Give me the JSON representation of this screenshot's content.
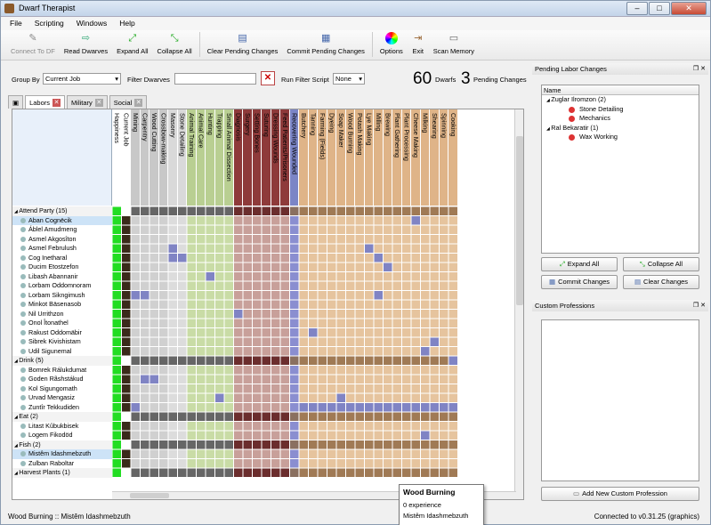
{
  "window": {
    "title": "Dwarf Therapist"
  },
  "menu": [
    "File",
    "Scripting",
    "Windows",
    "Help"
  ],
  "toolbar": {
    "connect": "Connect To DF",
    "read": "Read Dwarves",
    "expand": "Expand All",
    "collapse": "Collapse All",
    "clear": "Clear Pending Changes",
    "commit": "Commit Pending Changes",
    "options": "Options",
    "exit": "Exit",
    "scan": "Scan Memory"
  },
  "controls": {
    "group_by_label": "Group By",
    "group_by_value": "Current Job",
    "filter_label": "Filter Dwarves",
    "filter_value": "",
    "script_label": "Run Filter Script",
    "script_value": "None",
    "dwarf_count": "60",
    "dwarfs_label": "Dwarfs",
    "pending_count": "3",
    "pending_label": "Pending Changes"
  },
  "tabs": [
    "Labors",
    "Military",
    "Social"
  ],
  "columns": [
    "Happiness",
    "Current Job",
    "Mining",
    "Carpentry",
    "Wood Cutting",
    "Crossbow-making",
    "Masonry",
    "Stone Detailing",
    "Animal Training",
    "Animal Care",
    "Hunting",
    "Trapping",
    "Small Animal Dissection",
    "Diagnosis",
    "Surgery",
    "Setting Bones",
    "Suturing",
    "Dressing Wounds",
    "Feed Patients/Prisoners",
    "Recovering Wounded",
    "Butchery",
    "Tanning",
    "Farming (Fields)",
    "Dyeing",
    "Soap Maker",
    "Wood Burning",
    "Potash Making",
    "Lye Making",
    "Milling",
    "Brewing",
    "Plant Gathering",
    "Plant Processing",
    "Cheese Making",
    "Milking",
    "Shearing",
    "Spinning",
    "Cooking"
  ],
  "rows": [
    {
      "type": "group",
      "label": "Attend Party (15)"
    },
    {
      "type": "dwarf",
      "name": "Aban Cognëcik",
      "selected": true
    },
    {
      "type": "dwarf",
      "name": "Áblel Amudmeng"
    },
    {
      "type": "dwarf",
      "name": "Asmel Akgosîton"
    },
    {
      "type": "dwarf",
      "name": "Asmel Februlush"
    },
    {
      "type": "dwarf",
      "name": "Cog Inetharal"
    },
    {
      "type": "dwarf",
      "name": "Ducim Etostzefon"
    },
    {
      "type": "dwarf",
      "name": "Libash Abannanir"
    },
    {
      "type": "dwarf",
      "name": "Lorbam Oddomnoram"
    },
    {
      "type": "dwarf",
      "name": "Lorbam Sikngimush"
    },
    {
      "type": "dwarf",
      "name": "Minkot Bäsenasob"
    },
    {
      "type": "dwarf",
      "name": "Nil Urrithzon"
    },
    {
      "type": "dwarf",
      "name": "Onol Îtonathel"
    },
    {
      "type": "dwarf",
      "name": "Rakust Oddomäbir"
    },
    {
      "type": "dwarf",
      "name": "Sibrek Kivishistam"
    },
    {
      "type": "dwarf",
      "name": "Udil Sigunemal"
    },
    {
      "type": "group",
      "label": "Drink (5)"
    },
    {
      "type": "dwarf",
      "name": "Bomrek Rálukdumat"
    },
    {
      "type": "dwarf",
      "name": "Goden Rãshstákud"
    },
    {
      "type": "dwarf",
      "name": "Kol Sigungomath"
    },
    {
      "type": "dwarf",
      "name": "Urvad Mengasiz"
    },
    {
      "type": "dwarf",
      "name": "Zuntîr Tekkudiden"
    },
    {
      "type": "group",
      "label": "Eat (2)"
    },
    {
      "type": "dwarf",
      "name": "Litast Kûbukbisek"
    },
    {
      "type": "dwarf",
      "name": "Logem Fikodöd"
    },
    {
      "type": "group",
      "label": "Fish (2)"
    },
    {
      "type": "dwarf",
      "name": "Mistêm Idashmebzuth",
      "selected": true
    },
    {
      "type": "dwarf",
      "name": "Zulban Raboltar"
    },
    {
      "type": "group",
      "label": "Harvest Plants (1)"
    }
  ],
  "pending": {
    "title": "Pending Labor Changes",
    "header": "Name",
    "items": [
      {
        "level": 1,
        "label": "Zuglar Ilromzon (2)"
      },
      {
        "level": 2,
        "label": "Stone Detailing"
      },
      {
        "level": 2,
        "label": "Mechanics"
      },
      {
        "level": 1,
        "label": "Ral Bekaratir (1)"
      },
      {
        "level": 2,
        "label": "Wax Working"
      }
    ],
    "expand": "Expand All",
    "collapse": "Collapse All",
    "commit": "Commit Changes",
    "clear": "Clear Changes"
  },
  "custom": {
    "title": "Custom Professions",
    "add": "Add New Custom Profession"
  },
  "status": {
    "left": "Wood Burning :: Mistêm Idashmebzuth",
    "right": "Connected to v0.31.25 (graphics)"
  },
  "tooltip": {
    "title": "Wood Burning",
    "line1": "0 experience",
    "line2": "Mistêm Idashmebzuth"
  },
  "colors": {
    "gray": "#c8c8c8",
    "green": "#b9cf92",
    "red": "#8e3a3a",
    "blue": "#7b85c6",
    "tan": "#dfb488",
    "happy": "#22dd22",
    "enabled": "#8084c4"
  }
}
